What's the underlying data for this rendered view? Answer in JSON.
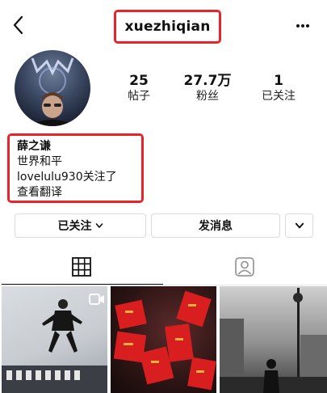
{
  "header": {
    "username": "xuezhiqian",
    "back_icon": "chevron-left-icon",
    "more_icon": "more-dots-icon"
  },
  "stats": [
    {
      "value": "25",
      "label": "帖子"
    },
    {
      "value": "27.7万",
      "label": "粉丝"
    },
    {
      "value": "1",
      "label": "已关注"
    }
  ],
  "bio": {
    "name": "薛之谦",
    "text": "世界和平",
    "followed_by": "lovelulu930关注了",
    "translate": "查看翻译"
  },
  "actions": {
    "following_label": "已关注",
    "message_label": "发消息",
    "dropdown_icon": "chevron-down-icon"
  },
  "tabs": [
    {
      "name": "grid",
      "icon": "grid-icon",
      "active": true
    },
    {
      "name": "tagged",
      "icon": "tagged-person-icon",
      "active": false
    }
  ],
  "colors": {
    "highlight": "#e8242b",
    "border": "#dbdbdb",
    "text": "#111111"
  },
  "posts": [
    {
      "kind": "video",
      "icon": "video-icon"
    },
    {
      "kind": "photo"
    },
    {
      "kind": "photo"
    }
  ]
}
